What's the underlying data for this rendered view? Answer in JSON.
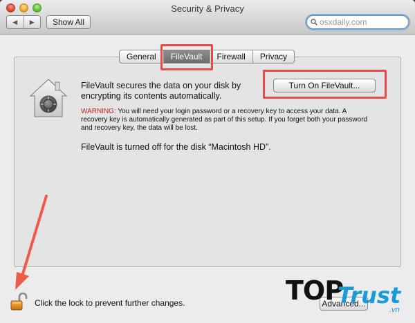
{
  "window": {
    "title": "Security & Privacy"
  },
  "toolbar": {
    "back_glyph": "◀",
    "forward_glyph": "▶",
    "show_all_label": "Show All",
    "search_value": "osxdaily.com"
  },
  "tabs": [
    {
      "label": "General",
      "selected": false
    },
    {
      "label": "FileVault",
      "selected": true
    },
    {
      "label": "Firewall",
      "selected": false
    },
    {
      "label": "Privacy",
      "selected": false
    }
  ],
  "filevault": {
    "description": "FileVault secures the data on your disk by encrypting its contents automatically.",
    "turn_on_label": "Turn On FileVault...",
    "warning_label": "WARNING:",
    "warning_text": " You will need your login password or a recovery key to access your data. A recovery key is automatically generated as part of this setup. If you forget both your password and recovery key, the data will be lost.",
    "status": "FileVault is turned off for the disk “Macintosh HD”."
  },
  "footer": {
    "lock_text": "Click the lock to prevent further changes.",
    "advanced_label": "Advanced..."
  },
  "watermark": {
    "top": "TOP",
    "trust": "Trust",
    "vn": ".vn"
  },
  "colors": {
    "annotation_red": "#e84a4a",
    "warning_red": "#d01d1d",
    "watermark_blue": "#1a9ad6"
  }
}
